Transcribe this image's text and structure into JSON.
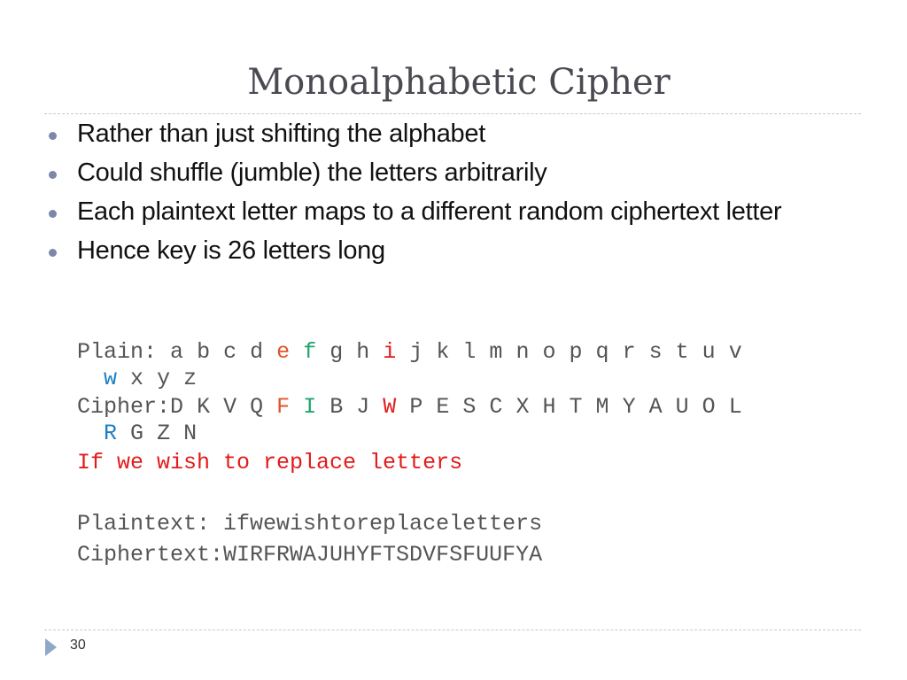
{
  "slide": {
    "title": "Monoalphabetic Cipher",
    "bullets": [
      "Rather than just shifting the alphabet",
      "Could shuffle (jumble) the letters arbitrarily",
      "Each plaintext letter maps to a different random ciphertext letter",
      "Hence key is 26 letters long"
    ],
    "plain_label": "Plain: ",
    "plain_letters": [
      "a",
      "b",
      "c",
      "d",
      "e",
      "f",
      "g",
      "h",
      "i",
      "j",
      "k",
      "l",
      "m",
      "n",
      "o",
      "p",
      "q",
      "r",
      "s",
      "t",
      "u",
      "v",
      "w",
      "x",
      "y",
      "z"
    ],
    "cipher_label": "Cipher:",
    "cipher_letters": [
      "D",
      "K",
      "V",
      "Q",
      "F",
      "I",
      "B",
      "J",
      "W",
      "P",
      "E",
      "S",
      "C",
      "X",
      "H",
      "T",
      "M",
      "Y",
      "A",
      "U",
      "O",
      "L",
      "R",
      "G",
      "Z",
      "N"
    ],
    "highlights": {
      "e": "orange",
      "f": "green",
      "i": "red",
      "w": "blue"
    },
    "example_sentence": "If we wish to replace letters",
    "plaintext_line": "Plaintext: ifwewishtoreplaceletters",
    "ciphertext_line": "Ciphertext:WIRFRWAJUHYFTSDVFSFUUFYA",
    "page_number": "30",
    "colors": {
      "orange": "#e0552a",
      "green": "#1ea66b",
      "red": "#e31b1b",
      "blue": "#1b7fc4",
      "bullet": "#7d87a8"
    }
  }
}
